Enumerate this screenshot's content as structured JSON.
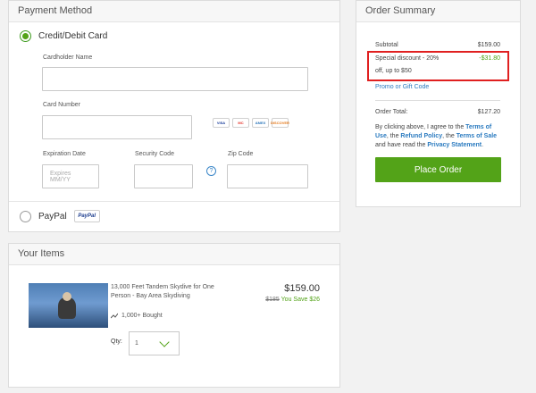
{
  "payment": {
    "header": "Payment Method",
    "credit_label": "Credit/Debit Card",
    "cardholder_label": "Cardholder Name",
    "cardholder_value": "",
    "card_number_label": "Card Number",
    "card_number_value": "",
    "card_logos": [
      "VISA",
      "MC",
      "AMEX",
      "DISCOVER"
    ],
    "expiration_label": "Expiration Date",
    "expiration_placeholder": "Expires MM/YY",
    "security_label": "Security Code",
    "security_value": "",
    "help_icon": "?",
    "zip_label": "Zip Code",
    "zip_value": "",
    "paypal_label": "PayPal",
    "paypal_badge": "PayPal"
  },
  "items": {
    "header": "Your Items",
    "list": [
      {
        "title": "13,000 Feet Tandem Skydive for One Person - Bay Area Skydiving",
        "price": "$159.00",
        "old_price": "$185",
        "save_text": "You Save $26",
        "bought": "1,000+ Bought",
        "qty_label": "Qty:",
        "qty_value": "1"
      }
    ]
  },
  "summary": {
    "header": "Order Summary",
    "subtotal_label": "Subtotal",
    "subtotal_value": "$159.00",
    "discount_label_line1": "Special discount - 20%",
    "discount_label_line2": "off, up to $50",
    "discount_value": "-$31.80",
    "promo_link": "Promo or Gift Code",
    "total_label": "Order Total:",
    "total_value": "$127.20",
    "terms_pre": "By clicking above, I agree to the ",
    "terms_link1": "Terms of Use",
    "terms_mid1": ", the ",
    "terms_link2": "Refund Policy",
    "terms_mid2": ", the ",
    "terms_link3": "Terms of Sale",
    "terms_mid3": " and have read the ",
    "terms_link4": "Privacy Statement",
    "terms_end": ".",
    "place_order": "Place Order"
  }
}
